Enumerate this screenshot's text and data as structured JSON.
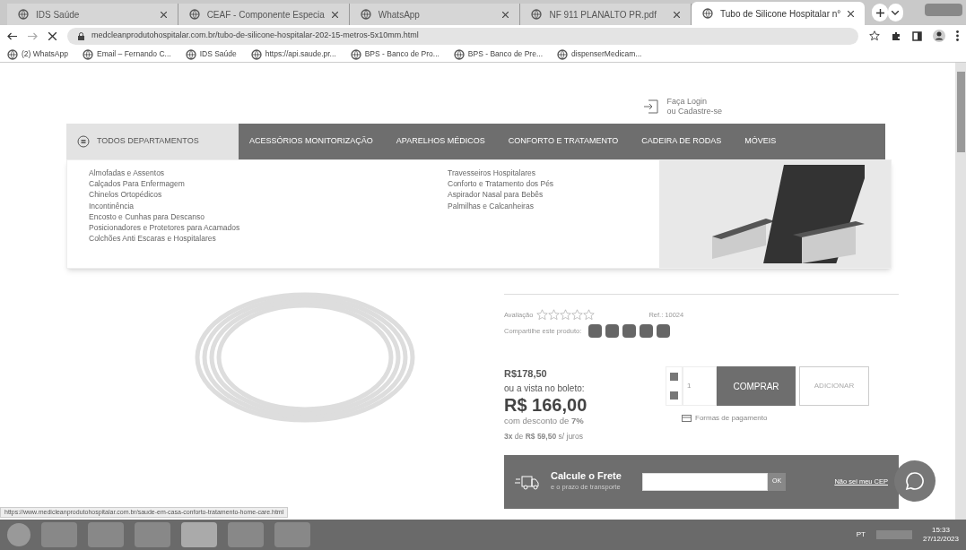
{
  "browser": {
    "tabs": [
      {
        "title": "IDS Saúde",
        "selected": false
      },
      {
        "title": "CEAF - Componente Especia",
        "selected": false
      },
      {
        "title": "WhatsApp",
        "selected": false
      },
      {
        "title": "NF 911 PLANALTO PR.pdf",
        "selected": false
      },
      {
        "title": "Tubo de Silicone Hospitalar n°",
        "selected": true
      }
    ],
    "url": "medcleanprodutohospitalar.com.br/tubo-de-silicone-hospitalar-202-15-metros-5x10mm.html",
    "bookmarks": [
      "(2) WhatsApp",
      "Email – Fernando C...",
      "IDS Saúde",
      "https://api.saude.pr...",
      "BPS - Banco de Pro...",
      "BPS - Banco de Pre...",
      "dispenserMedicam..."
    ]
  },
  "header": {
    "login": "Faça Login",
    "register": "ou Cadastre-se"
  },
  "nav": {
    "all_departments": "TODOS DEPARTAMENTOS",
    "items": [
      "ACESSÓRIOS MONITORIZAÇÃO",
      "APARELHOS MÉDICOS",
      "CONFORTO E TRATAMENTO",
      "CADEIRA DE RODAS",
      "MÓVEIS"
    ]
  },
  "dropdown": {
    "column_1": [
      "Almofadas e Assentos",
      "Calçados Para Enfermagem",
      "Chinelos Ortopédicos",
      "Incontinência",
      "Encosto e Cunhas para Descanso",
      "Posicionadores e Protetores para Acamados",
      "Colchões Anti Escaras e Hospitalares"
    ],
    "column_2": [
      "Travesseiros Hospitalares",
      "Conforto e Tratamento dos Pés",
      "Aspirador Nasal para Bebês",
      "Palmilhas e Calcanheiras"
    ]
  },
  "product": {
    "rating_label": "Avaliação",
    "stars": 0,
    "ref": "Ref.: 10024",
    "share_label": "Compartilhe este produto:",
    "price": "R$178,50",
    "boleto_label": "ou a vista no boleto:",
    "boleto_price": "R$ 166,00",
    "discount": "com desconto de **7%**",
    "installments": "**3x** de **R$ 59,50** s/ juros",
    "quantity": "1",
    "buy": "COMPRAR",
    "add": "ADICIONAR",
    "payment_link": "Formas de pagamento"
  },
  "shipping": {
    "title": "Calcule o Frete",
    "subtitle": "e o prazo de transporte",
    "ok": "OK",
    "cep_link": "Não sei meu CEP"
  },
  "status_url": "https://www.medicleanprodutohospitalar.com.br/saude-em-casa-conforto-tratamento-home-care.html",
  "taskbar": {
    "language": "PT",
    "time": "15:33",
    "date": "27/12/2023"
  }
}
